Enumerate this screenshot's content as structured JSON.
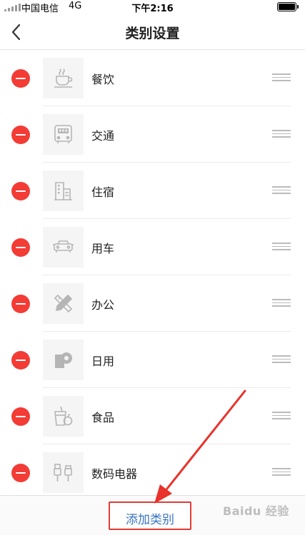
{
  "status_bar": {
    "carrier": "中国电信",
    "network": "4G",
    "time": "下午2:16"
  },
  "nav": {
    "title": "类别设置"
  },
  "categories": [
    {
      "label": "餐饮",
      "icon": "coffee-cup-icon"
    },
    {
      "label": "交通",
      "icon": "bus-icon"
    },
    {
      "label": "住宿",
      "icon": "building-icon"
    },
    {
      "label": "用车",
      "icon": "car-icon"
    },
    {
      "label": "办公",
      "icon": "pencil-ruler-icon"
    },
    {
      "label": "日用",
      "icon": "tissue-roll-icon"
    },
    {
      "label": "食品",
      "icon": "drink-apple-icon"
    },
    {
      "label": "数码电器",
      "icon": "usb-plug-icon"
    }
  ],
  "footer": {
    "add_label": "添加类别"
  },
  "watermark": "Baidu 经验",
  "colors": {
    "remove_red": "#f23c35",
    "add_text_blue": "#3a76c4",
    "highlight_red": "#e23b35",
    "icon_gray": "#b5b5b5"
  }
}
